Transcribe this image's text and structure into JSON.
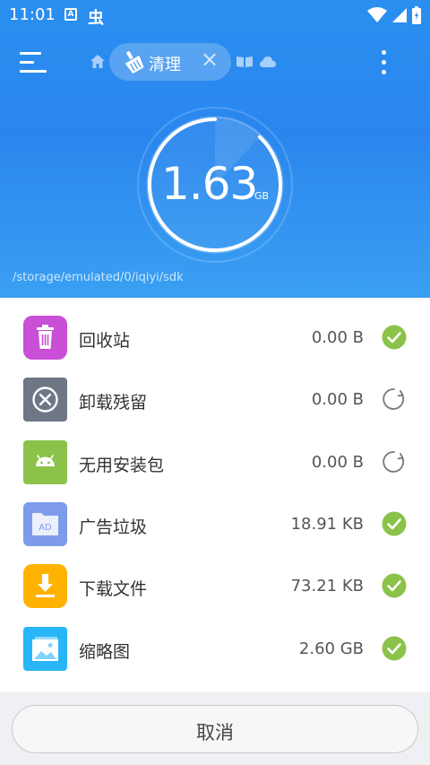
{
  "status_bar": {
    "time": "11:01",
    "notif_a": "A",
    "notif_bug": "虫"
  },
  "toolbar": {
    "active_tab_label": "清理",
    "icons": [
      "menu-icon",
      "home-icon",
      "broom-icon",
      "close-icon",
      "video-icon",
      "cloud-icon",
      "more-vert-icon"
    ]
  },
  "gauge": {
    "value": "1.63",
    "unit": "GB",
    "fill_fraction": 0.88
  },
  "path": "/storage/emulated/0/iqiyi/sdk",
  "items": [
    {
      "label": "回收站",
      "size": "0.00 B",
      "status": "checked",
      "icon": "trash-icon",
      "color": "#c84fd6"
    },
    {
      "label": "卸载残留",
      "size": "0.00 B",
      "status": "scanning",
      "icon": "uninstall-icon",
      "color": "#6e7785"
    },
    {
      "label": "无用安装包",
      "size": "0.00 B",
      "status": "scanning",
      "icon": "android-icon",
      "color": "#8bc34a"
    },
    {
      "label": "广告垃圾",
      "size": "18.91 KB",
      "status": "checked",
      "icon": "ad-icon",
      "color": "#7d9bea"
    },
    {
      "label": "下载文件",
      "size": "73.21 KB",
      "status": "checked",
      "icon": "download-icon",
      "color": "#ffb300"
    },
    {
      "label": "缩略图",
      "size": "2.60 GB",
      "status": "checked",
      "icon": "thumbnail-icon",
      "color": "#29b6f6"
    }
  ],
  "footer": {
    "cancel_label": "取消"
  },
  "colors": {
    "accent": "#2a86ee",
    "check_green": "#8bc34a"
  }
}
